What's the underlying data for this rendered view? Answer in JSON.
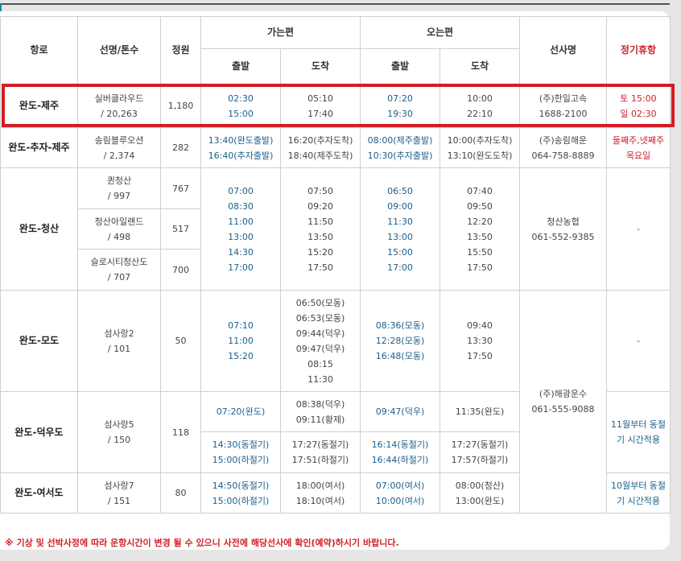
{
  "headers": {
    "route": "항로",
    "ship": "선명/톤수",
    "capacity": "정원",
    "outbound": "가는편",
    "inbound": "오는편",
    "depart": "출발",
    "arrive": "도착",
    "operator": "선사명",
    "holiday": "정기휴항"
  },
  "rows": [
    {
      "route": "완도-제주",
      "ship": [
        "실버클라우드",
        "/ 20,263"
      ],
      "capacity": "1,180",
      "out_dep": [
        "02:30",
        "15:00"
      ],
      "out_arr": [
        "05:10",
        "17:40"
      ],
      "in_dep": [
        "07:20",
        "19:30"
      ],
      "in_arr": [
        "10:00",
        "22:10"
      ],
      "operator": [
        "(주)한일고속",
        "1688-2100"
      ],
      "holiday": [
        "토 15:00",
        "일 02:30"
      ]
    },
    {
      "route": "완도-추자-제주",
      "ship": [
        "송림블루오션",
        "/ 2,374"
      ],
      "capacity": "282",
      "out_dep": [
        "13:40(완도출발)",
        "16:40(추자출발)"
      ],
      "out_arr": [
        "16:20(추자도착)",
        "18:40(제주도착)"
      ],
      "in_dep": [
        "08:00(제주출발)",
        "10:30(추자출발)"
      ],
      "in_arr": [
        "10:00(추자도착)",
        "13:10(완도도착)"
      ],
      "operator": [
        "(주)송림해운",
        "064-758-8889"
      ],
      "holiday": [
        "둘째주,넷째주",
        "목요일"
      ]
    },
    {
      "route": "완도-청산",
      "ships": [
        {
          "ship": [
            "퀸청산",
            "/ 997"
          ],
          "capacity": "767"
        },
        {
          "ship": [
            "청산아일랜드",
            "/ 498"
          ],
          "capacity": "517"
        },
        {
          "ship": [
            "슬로시티청산도",
            "/ 707"
          ],
          "capacity": "700"
        }
      ],
      "out_dep": [
        "07:00",
        "08:30",
        "11:00",
        "13:00",
        "14:30",
        "17:00"
      ],
      "out_arr": [
        "07:50",
        "09:20",
        "11:50",
        "13:50",
        "15:20",
        "17:50"
      ],
      "in_dep": [
        "06:50",
        "09:00",
        "11:30",
        "13:00",
        "15:00",
        "17:00"
      ],
      "in_arr": [
        "07:40",
        "09:50",
        "12:20",
        "13:50",
        "15:50",
        "17:50"
      ],
      "operator": [
        "청산농협",
        "061-552-9385"
      ],
      "holiday": "-"
    },
    {
      "route": "완도-모도",
      "ship": [
        "섬사랑2",
        "/ 101"
      ],
      "capacity": "50",
      "out_dep": [
        "07:10",
        "11:00",
        "15:20"
      ],
      "out_arr": [
        "06:50(모동)",
        "06:53(모동)",
        "09:44(덕우)",
        "09:47(덕우)",
        "08:15",
        "11:30"
      ],
      "in_dep": [
        "08:36(모동)",
        "12:28(모동)",
        "16:48(모동)"
      ],
      "in_arr": [
        "09:40",
        "13:30",
        "17:50"
      ],
      "holiday": "-"
    },
    {
      "route": "완도-덕우도",
      "ship": [
        "섬사랑5",
        "/ 150"
      ],
      "capacity": "118",
      "sub": [
        {
          "out_dep": [
            "07:20(완도)"
          ],
          "out_arr": [
            "08:38(덕우)",
            "09:11(황제)"
          ],
          "in_dep": [
            "09:47(덕우)"
          ],
          "in_arr": [
            "11:35(완도)"
          ]
        },
        {
          "out_dep": [
            "14:30(동절기)",
            "15:00(하절기)"
          ],
          "out_arr": [
            "17:27(동절기)",
            "17:51(하절기)"
          ],
          "in_dep": [
            "16:14(동절기)",
            "16:44(하절기)"
          ],
          "in_arr": [
            "17:27(동절기)",
            "17:57(하절기)"
          ]
        }
      ],
      "operator": [
        "(주)해광운수",
        "061-555-9088"
      ],
      "holiday": [
        "11월부터 동절",
        "기 시간적용"
      ]
    },
    {
      "route": "완도-여서도",
      "ship": [
        "섬사랑7",
        "/ 151"
      ],
      "capacity": "80",
      "out_dep": [
        "14:50(동절기)",
        "15:00(하절기)"
      ],
      "out_arr": [
        "18:00(여서)",
        "18:10(여서)"
      ],
      "in_dep": [
        "07:00(여서)",
        "10:00(여서)"
      ],
      "in_arr": [
        "08:00(청산)",
        "13:00(완도)"
      ],
      "holiday": [
        "10월부터 동절",
        "기 시간적용"
      ]
    }
  ],
  "notice": "※ 기상 및 선박사정에 따라 운항시간이 변경 될 수 있으니 사전에 해당선사에 확인(예약)하시기 바랍니다.",
  "colors": {
    "accent_red": "#d31c26",
    "time_blue": "#1b5f8c",
    "holiday_red": "#cc1e28"
  }
}
